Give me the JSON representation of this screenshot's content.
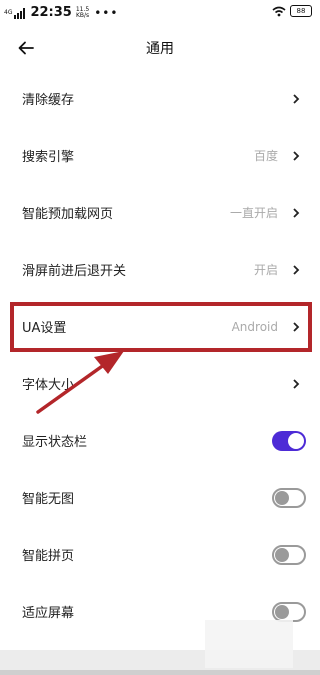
{
  "status_bar": {
    "network": "4G",
    "time": "22:35",
    "speed_value": "11.5",
    "speed_unit": "KB/s",
    "dots": "•••",
    "battery": "88"
  },
  "header": {
    "title": "通用"
  },
  "settings": [
    {
      "label": "清除缓存",
      "value": "",
      "control": "chevron"
    },
    {
      "label": "搜索引擎",
      "value": "百度",
      "control": "chevron"
    },
    {
      "label": "智能预加载网页",
      "value": "一直开启",
      "control": "chevron"
    },
    {
      "label": "滑屏前进后退开关",
      "value": "开启",
      "control": "chevron"
    },
    {
      "label": "UA设置",
      "value": "Android",
      "control": "chevron"
    },
    {
      "label": "字体大小",
      "value": "",
      "control": "chevron"
    },
    {
      "label": "显示状态栏",
      "value": "",
      "control": "toggle",
      "on": true
    },
    {
      "label": "智能无图",
      "value": "",
      "control": "toggle",
      "on": false
    },
    {
      "label": "智能拼页",
      "value": "",
      "control": "toggle",
      "on": false
    },
    {
      "label": "适应屏幕",
      "value": "",
      "control": "toggle",
      "on": false
    }
  ],
  "colors": {
    "accent": "#4d2bd6",
    "annotation": "#b3262a",
    "value_text": "#aaaaaa"
  }
}
